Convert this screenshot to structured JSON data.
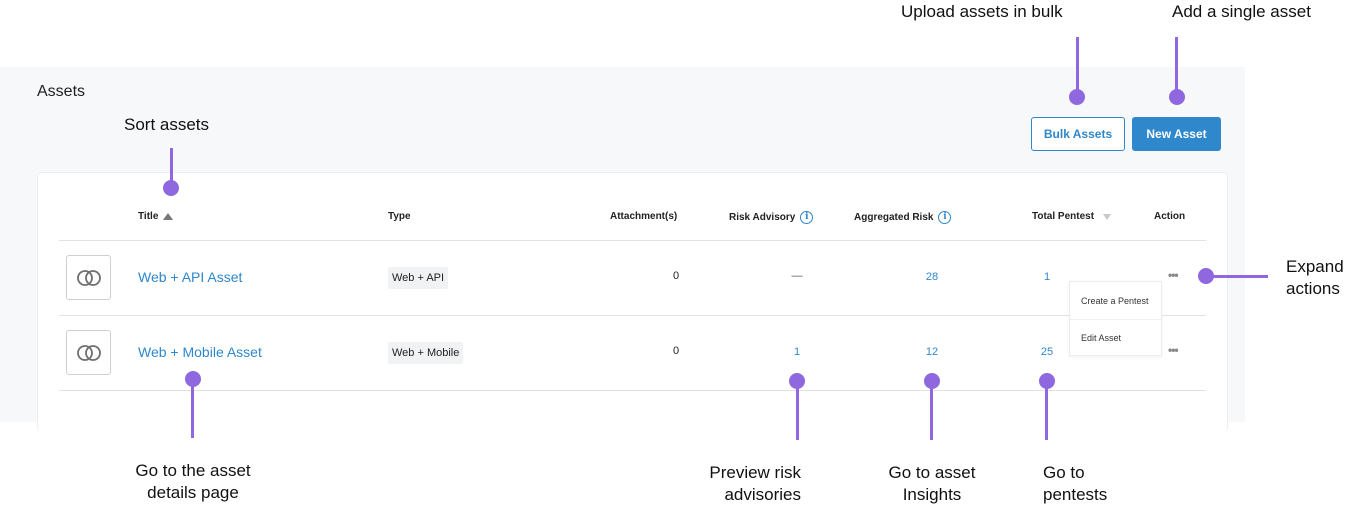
{
  "page": {
    "title": "Assets",
    "buttons": {
      "bulk": "Bulk Assets",
      "new": "New Asset"
    }
  },
  "table": {
    "columns": {
      "title": "Title",
      "type": "Type",
      "attachments": "Attachment(s)",
      "risk_advisory": "Risk Advisory",
      "aggregated_risk": "Aggregated Risk",
      "total_pentest": "Total Pentest",
      "action": "Action"
    },
    "sort": {
      "column": "Title",
      "direction": "ascending"
    },
    "rows": [
      {
        "title": "Web + API Asset",
        "type": "Web + API",
        "attachments": "0",
        "risk_advisory": "—",
        "aggregated_risk": "28",
        "total_pentest": "1",
        "icon": "linked-rings-icon"
      },
      {
        "title": "Web + Mobile Asset",
        "type": "Web + Mobile",
        "attachments": "0",
        "risk_advisory": "1",
        "aggregated_risk": "12",
        "total_pentest": "25",
        "icon": "linked-rings-icon"
      }
    ],
    "action_menu": {
      "items": [
        "Create a Pentest",
        "Edit Asset"
      ]
    }
  },
  "annotations": {
    "bulk": "Upload assets in bulk",
    "single": "Add a single asset",
    "sort": "Sort assets",
    "expand": [
      "Expand",
      "actions"
    ],
    "details": [
      "Go to the asset",
      "details page"
    ],
    "risk": [
      "Preview risk",
      "advisories"
    ],
    "insights": [
      "Go to asset",
      "Insights"
    ],
    "pentests": [
      "Go to",
      "pentests"
    ]
  },
  "colors": {
    "accent": "#2f87cc",
    "annotation": "#8f68e0",
    "panel_bg": "#f7f8fa"
  }
}
